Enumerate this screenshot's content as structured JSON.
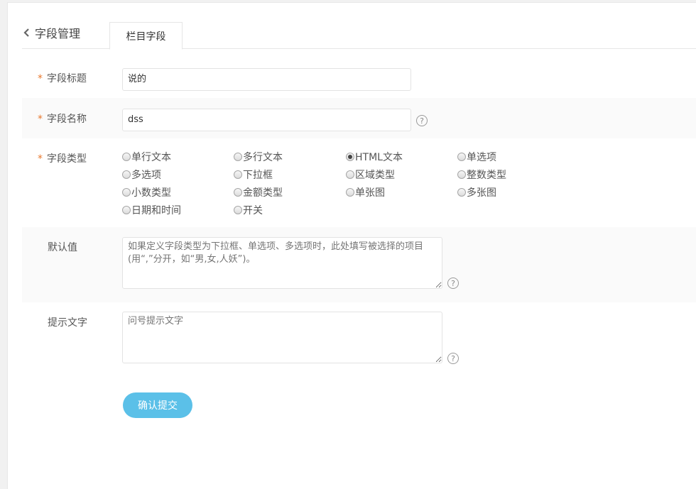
{
  "header": {
    "back_label": "字段管理",
    "tab_label": "栏目字段"
  },
  "form": {
    "title": {
      "label": "字段标题",
      "value": "说的"
    },
    "name": {
      "label": "字段名称",
      "value": "dss",
      "help": "?"
    },
    "type": {
      "label": "字段类型",
      "selected": "HTML文本",
      "options": [
        "单行文本",
        "多行文本",
        "HTML文本",
        "单选项",
        "多选项",
        "下拉框",
        "区域类型",
        "整数类型",
        "小数类型",
        "金额类型",
        "单张图",
        "多张图",
        "日期和时间",
        "开关"
      ]
    },
    "default": {
      "label": "默认值",
      "placeholder": "如果定义字段类型为下拉框、单选项、多选项时，此处填写被选择的项目(用“,”分开，如“男,女,人妖”)。",
      "help": "?"
    },
    "hint": {
      "label": "提示文字",
      "placeholder": "问号提示文字",
      "help": "?"
    },
    "required_mark": "*",
    "submit_label": "确认提交"
  },
  "colors": {
    "required": "#e8782e",
    "submit_bg": "#5bc0e8"
  }
}
